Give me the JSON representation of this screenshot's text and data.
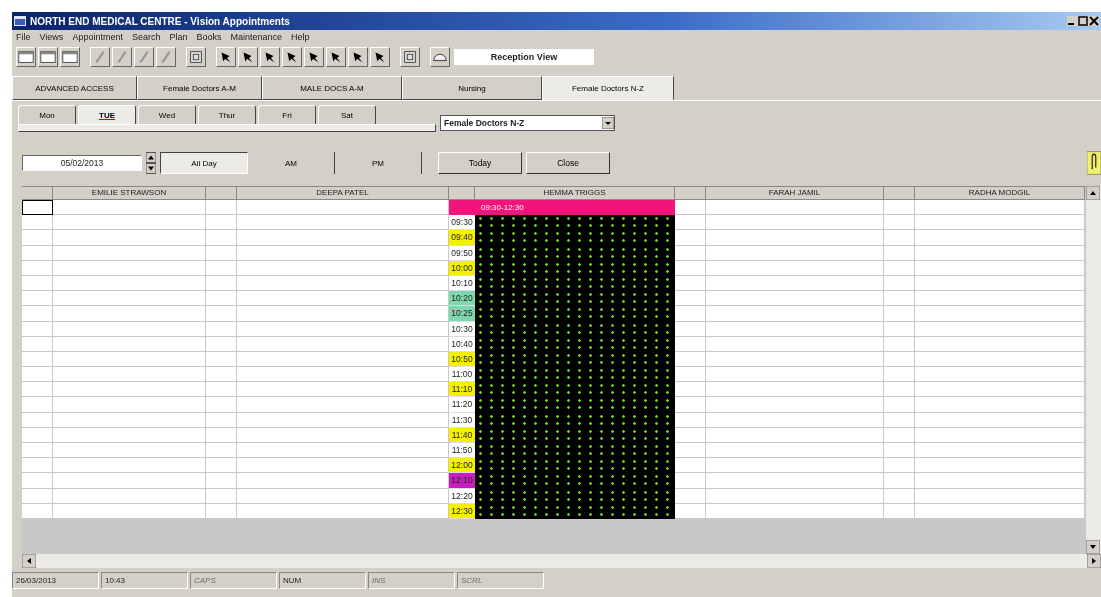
{
  "window": {
    "title": "NORTH END MEDICAL CENTRE - Vision Appointments"
  },
  "menu": [
    "File",
    "Views",
    "Appointment",
    "Search",
    "Plan",
    "Books",
    "Maintenance",
    "Help"
  ],
  "view_label": "Reception View",
  "group_tabs": [
    {
      "label": "ADVANCED ACCESS",
      "selected": false
    },
    {
      "label": "Female Doctors A-M",
      "selected": false
    },
    {
      "label": "MALE DOCS A-M",
      "selected": false
    },
    {
      "label": "Nursing",
      "selected": false
    },
    {
      "label": "Female Doctors N-Z",
      "selected": true
    }
  ],
  "day_tabs": [
    {
      "label": "Mon",
      "selected": false
    },
    {
      "label": "TUE",
      "selected": true
    },
    {
      "label": "Wed",
      "selected": false
    },
    {
      "label": "Thur",
      "selected": false
    },
    {
      "label": "Fri",
      "selected": false
    },
    {
      "label": "Sat",
      "selected": false
    }
  ],
  "group_select": {
    "value": "Female Doctors N-Z"
  },
  "date_field": {
    "value": "05/02/2013"
  },
  "periods": [
    {
      "label": "All Day",
      "selected": true
    },
    {
      "label": "AM",
      "selected": false
    },
    {
      "label": "PM",
      "selected": false
    }
  ],
  "buttons": [
    "Today",
    "Close"
  ],
  "columns": [
    "EMILIE STRAWSON",
    "DEEPA PATEL",
    "HEMMA TRIGGS",
    "FARAH JAMIL",
    "RADHA MODGIL"
  ],
  "session": {
    "label": "09:30-12:30",
    "color": "#f0147c"
  },
  "slots": [
    {
      "time": "09:30",
      "color": "#ffffff"
    },
    {
      "time": "09:40",
      "color": "#f4f000"
    },
    {
      "time": "09:50",
      "color": "#ffffff"
    },
    {
      "time": "10:00",
      "color": "#f4f000"
    },
    {
      "time": "10:10",
      "color": "#ffffff"
    },
    {
      "time": "10:20",
      "color": "#7ed6ae"
    },
    {
      "time": "10:25",
      "color": "#7ed6ae"
    },
    {
      "time": "10:30",
      "color": "#ffffff"
    },
    {
      "time": "10:40",
      "color": "#ffffff"
    },
    {
      "time": "10:50",
      "color": "#f4f000"
    },
    {
      "time": "11:00",
      "color": "#ffffff"
    },
    {
      "time": "11:10",
      "color": "#f4f000"
    },
    {
      "time": "11:20",
      "color": "#ffffff"
    },
    {
      "time": "11:30",
      "color": "#ffffff"
    },
    {
      "time": "11:40",
      "color": "#f4f000"
    },
    {
      "time": "11:50",
      "color": "#ffffff"
    },
    {
      "time": "12:00",
      "color": "#f4f000"
    },
    {
      "time": "12:10",
      "color": "#c81ec0"
    },
    {
      "time": "12:20",
      "color": "#ffffff"
    },
    {
      "time": "12:30",
      "color": "#f4f000"
    }
  ],
  "status_bar": [
    {
      "text": "26/03/2013",
      "disabled": false
    },
    {
      "text": "10:43",
      "disabled": false
    },
    {
      "text": "CAPS",
      "disabled": true
    },
    {
      "text": "NUM",
      "disabled": false
    },
    {
      "text": "INS",
      "disabled": true
    },
    {
      "text": "SCRL",
      "disabled": true
    }
  ]
}
